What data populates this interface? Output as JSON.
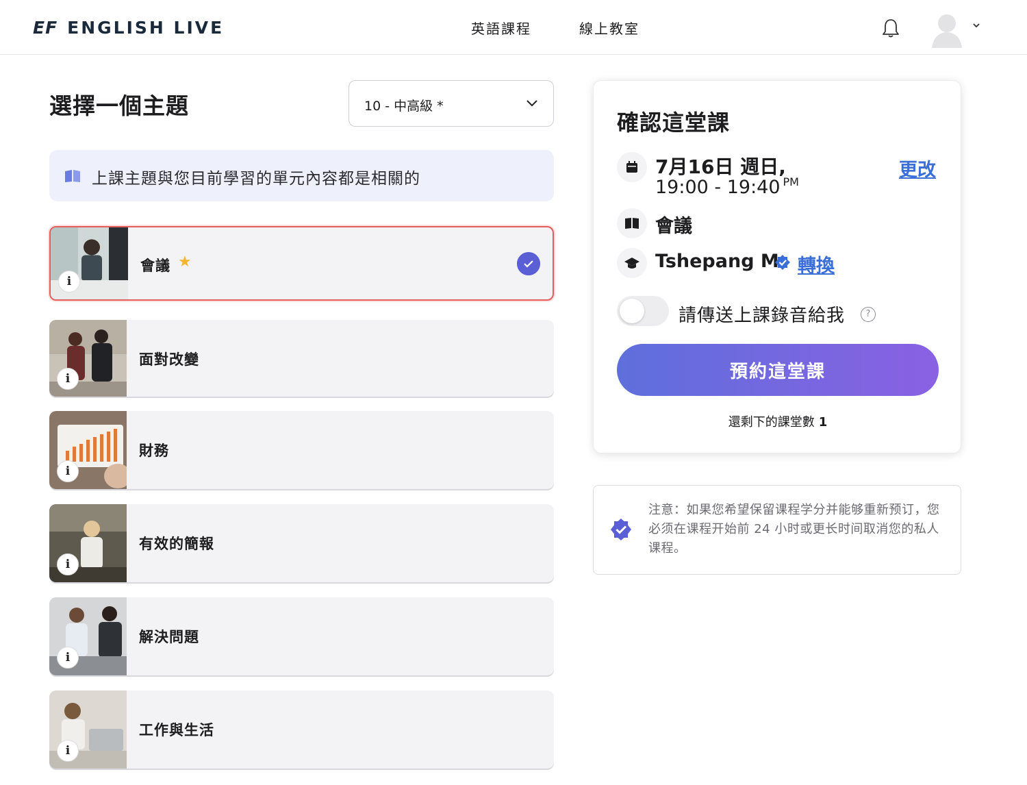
{
  "header": {
    "logo_ef": "EF",
    "logo_text": "ENGLISH LIVE",
    "nav": [
      {
        "label": "英語課程"
      },
      {
        "label": "線上教室"
      }
    ],
    "bell_icon": "bell-icon",
    "avatar_icon": "user-avatar-icon"
  },
  "left": {
    "title": "選擇一個主題",
    "level_select_value": "10 - 中高級 *",
    "info_banner": "上課主題與您目前學習的單元內容都是相關的",
    "topics": [
      {
        "label": "會議",
        "starred": true,
        "selected": true
      },
      {
        "label": "面對改變",
        "starred": false,
        "selected": false
      },
      {
        "label": "財務",
        "starred": false,
        "selected": false
      },
      {
        "label": "有效的簡報",
        "starred": false,
        "selected": false
      },
      {
        "label": "解決問題",
        "starred": false,
        "selected": false
      },
      {
        "label": "工作與生活",
        "starred": false,
        "selected": false
      }
    ],
    "info_glyph": "i"
  },
  "confirm": {
    "title": "確認這堂課",
    "date": "7月16日 週日,",
    "time": "19:00 - 19:40",
    "time_suffix": "PM",
    "change_label": "更改",
    "topic": "會議",
    "teacher": "Tshepang M.",
    "switch_label": "轉換",
    "recording_label": "請傳送上課錄音給我",
    "recording_on": false,
    "help_glyph": "?",
    "book_button": "預約這堂課",
    "remaining_label": "還剩下的課堂數",
    "remaining_count": "1"
  },
  "notice": {
    "text": "注意：如果您希望保留课程学分并能够重新预订，您必须在课程开始前 24 小时或更长时间取消您的私人课程。"
  },
  "colors": {
    "accent": "#5b5fd6",
    "link": "#3b6fd8",
    "selected_border": "#e35d5d",
    "star": "#f4b52c"
  }
}
